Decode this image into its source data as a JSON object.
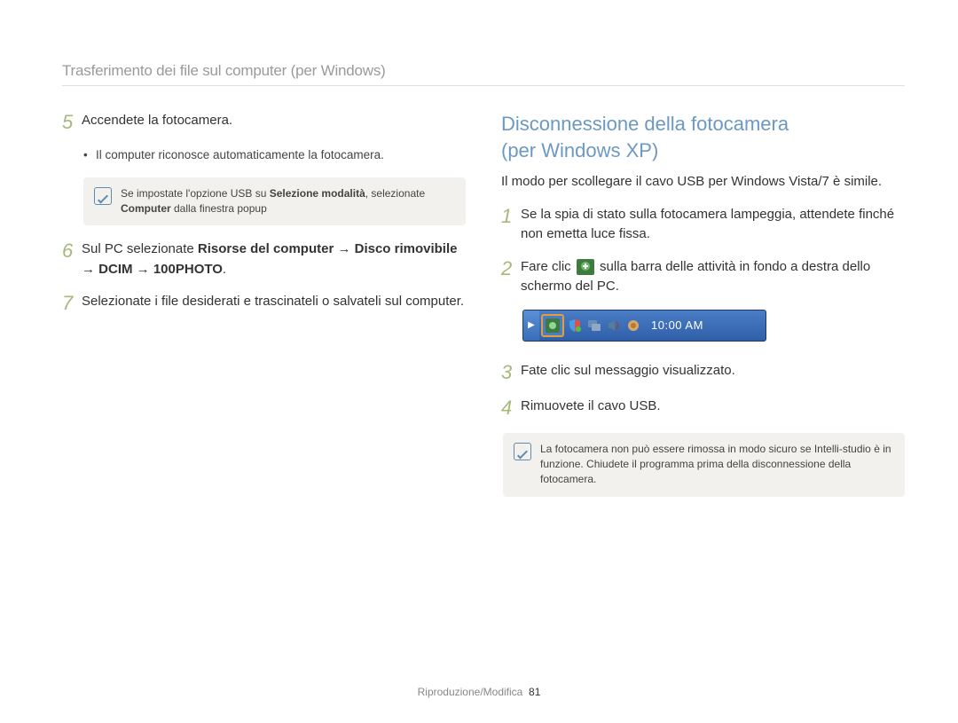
{
  "header": {
    "title": "Trasferimento dei file sul computer (per Windows)"
  },
  "left": {
    "step5": {
      "num": "5",
      "text": "Accendete la fotocamera.",
      "bullet": "Il computer riconosce automaticamente la fotocamera.",
      "note_prefix": "Se impostate l'opzione USB su ",
      "note_bold1": "Selezione modalità",
      "note_mid": ", selezionate ",
      "note_bold2": "Computer",
      "note_suffix": " dalla finestra popup"
    },
    "step6": {
      "num": "6",
      "prefix": "Sul PC selezionate ",
      "bold": "Risorse del computer → Disco rimovibile → DCIM → 100PHOTO",
      "suffix": "."
    },
    "step7": {
      "num": "7",
      "text": "Selezionate i file desiderati e trascinateli o salvateli sul computer."
    }
  },
  "right": {
    "title": "Disconnessione della fotocamera\n(per Windows XP)",
    "intro": "Il modo per scollegare il cavo USB per Windows Vista/7 è simile.",
    "step1": {
      "num": "1",
      "text": "Se la spia di stato sulla fotocamera lampeggia, attendete finché non emetta luce fissa."
    },
    "step2": {
      "num": "2",
      "prefix": "Fare clic ",
      "suffix": " sulla barra delle attività in fondo a destra dello schermo del PC."
    },
    "taskbar_time": "10:00 AM",
    "step3": {
      "num": "3",
      "text": "Fate clic sul messaggio visualizzato."
    },
    "step4": {
      "num": "4",
      "text": "Rimuovete il cavo USB."
    },
    "note": "La fotocamera non può essere rimossa in modo sicuro se Intelli-studio è in funzione. Chiudete il programma prima della disconnessione della fotocamera."
  },
  "footer": {
    "section": "Riproduzione/Modifica",
    "page": "81"
  }
}
